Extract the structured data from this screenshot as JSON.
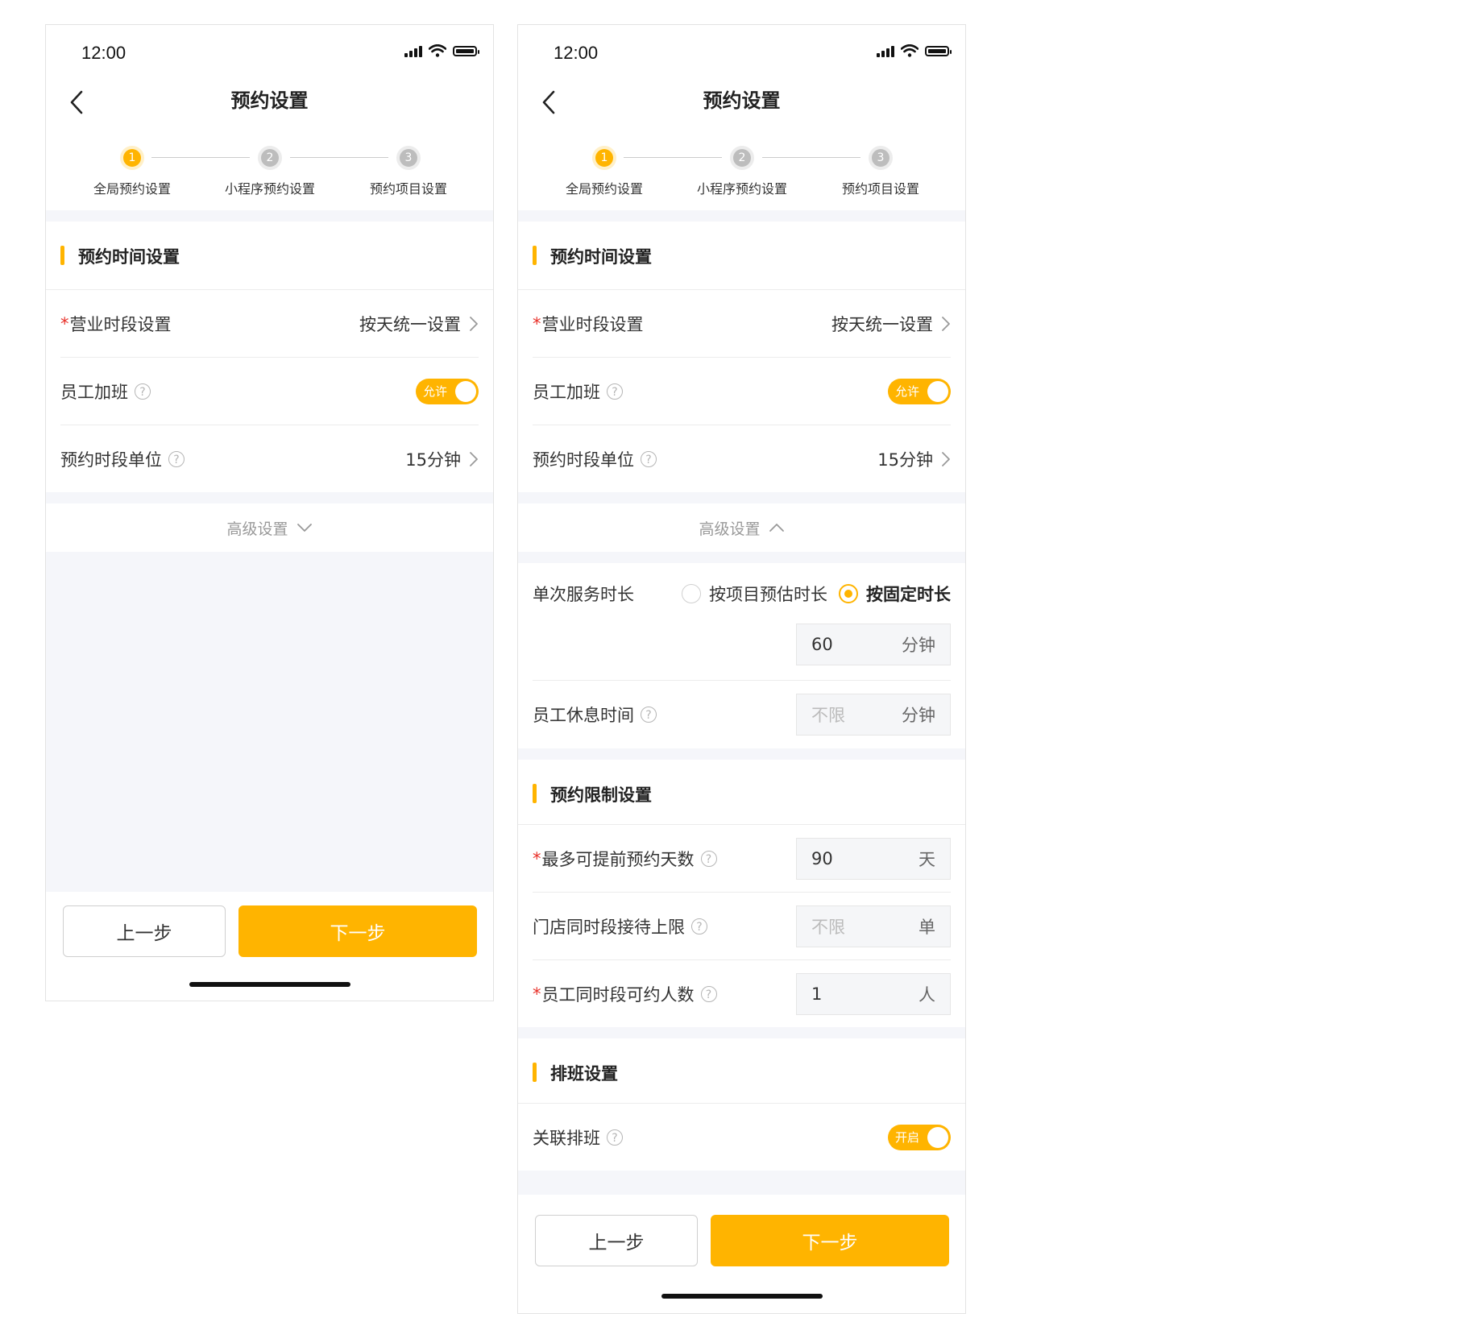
{
  "colors": {
    "accent": "#ffb400",
    "required": "#e8312a",
    "page_bg": "#f5f6fa"
  },
  "status_bar": {
    "time": "12:00",
    "icons": [
      "signal-icon",
      "wifi-icon",
      "battery-icon"
    ]
  },
  "nav": {
    "title": "预约设置",
    "back_icon": "chevron-left-icon"
  },
  "steps": [
    {
      "number": "1",
      "label": "全局预约设置",
      "state": "active"
    },
    {
      "number": "2",
      "label": "小程序预约设置",
      "state": "inactive"
    },
    {
      "number": "3",
      "label": "预约项目设置",
      "state": "inactive"
    }
  ],
  "time_section": {
    "title": "预约时间设置",
    "business_hours": {
      "required_mark": "*",
      "label": "营业时段设置",
      "value": "按天统一设置"
    },
    "overtime": {
      "label": "员工加班",
      "help": "?",
      "toggle_text": "允许",
      "on": true
    },
    "slot_unit": {
      "label": "预约时段单位",
      "help": "?",
      "value": "15分钟"
    }
  },
  "advanced": {
    "label": "高级设置",
    "collapsed_icon": "chevron-down-icon",
    "expanded_icon": "chevron-up-icon"
  },
  "service_duration": {
    "label": "单次服务时长",
    "options": [
      {
        "label": "按项目预估时长",
        "checked": false
      },
      {
        "label": "按固定时长",
        "checked": true
      }
    ],
    "value": "60",
    "unit": "分钟"
  },
  "rest_time": {
    "label": "员工休息时间",
    "help": "?",
    "placeholder": "不限",
    "unit": "分钟"
  },
  "limit_section": {
    "title": "预约限制设置",
    "max_days": {
      "required_mark": "*",
      "label": "最多可提前预约天数",
      "help": "?",
      "value": "90",
      "unit": "天"
    },
    "store_limit": {
      "label": "门店同时段接待上限",
      "help": "?",
      "placeholder": "不限",
      "unit": "单"
    },
    "staff_limit": {
      "required_mark": "*",
      "label": "员工同时段可约人数",
      "help": "?",
      "value": "1",
      "unit": "人"
    }
  },
  "schedule_section": {
    "title": "排班设置",
    "link_schedule": {
      "label": "关联排班",
      "help": "?",
      "toggle_text": "开启",
      "on": true
    }
  },
  "footer": {
    "prev_label": "上一步",
    "next_label": "下一步"
  }
}
